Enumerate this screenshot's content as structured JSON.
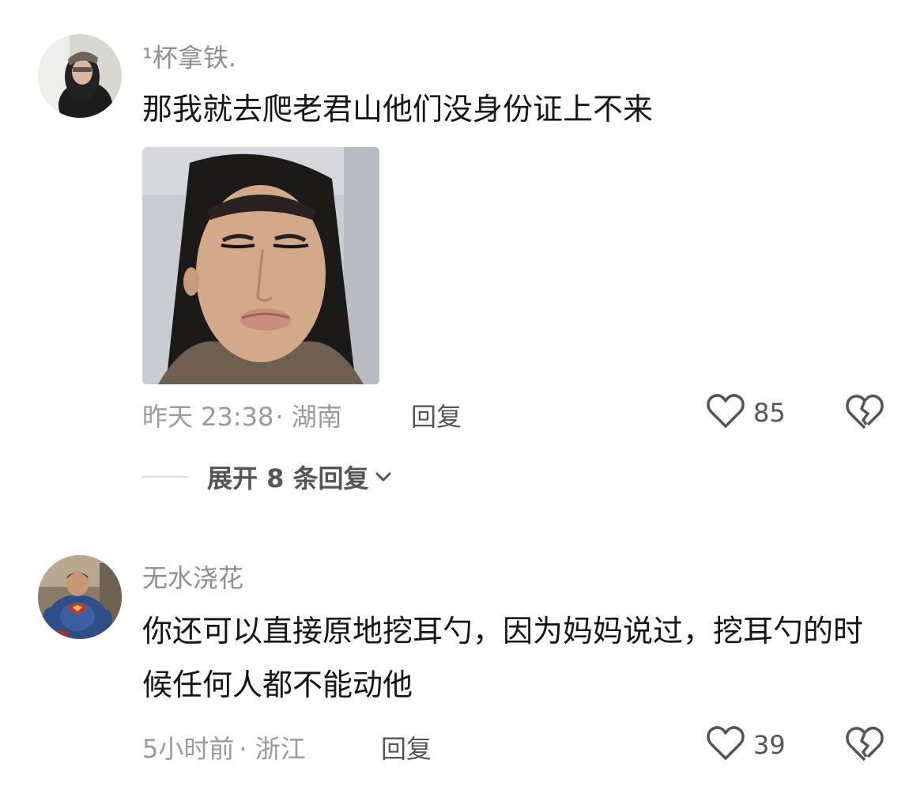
{
  "comments": [
    {
      "username": "¹杯拿铁.",
      "text": "那我就去爬老君山他们没身份证上不来",
      "time": "昨天 23:38",
      "location": "· 湖南",
      "reply_label": "回复",
      "likes": "85",
      "has_image": true
    },
    {
      "username": "无水浇花",
      "text": "你还可以直接原地挖耳勺，因为妈妈说过，挖耳勺的时候任何人都不能动他",
      "time": "5小时前",
      "location": "· 浙江",
      "reply_label": "回复",
      "likes": "39",
      "has_image": false
    }
  ],
  "expand_replies": {
    "label": "展开 8 条回复"
  },
  "icons": {
    "like": "heart-outline-icon",
    "dislike": "broken-heart-icon",
    "expand": "chevron-down-icon"
  },
  "colors": {
    "text_primary": "#161616",
    "text_secondary": "#9a9a9a",
    "action": "#555555"
  }
}
